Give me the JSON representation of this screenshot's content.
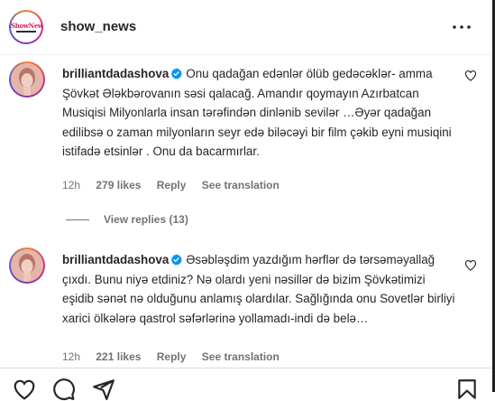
{
  "post": {
    "username": "show_news",
    "avatar_logo_text": "ShowNews"
  },
  "comments": [
    {
      "username": "brilliantdadashova",
      "text": "Onu qadağan edənlər ölüb gedəcəklər- amma Şövkət Ələkbərovanın səsi qalacağ. Amandır qoymayın Azırbatcan Musiqisi Milyonlarla insan tərəfindən dinlənib sevilər …Əyər qadağan edilibsə o zaman milyonların seyr edə biləcəyi bir film çəkib eyni musiqini istifadə etsinlər . Onu da bacarmırlar.",
      "time": "12h",
      "likes": "279 likes",
      "reply_label": "Reply",
      "translate_label": "See translation",
      "view_replies": "View replies (13)"
    },
    {
      "username": "brilliantdadashova",
      "text": "Əsəbləşdim yazdığım hərflər də tərsəməyallağ çıxdı. Bunu niyə etdiniz? Nə olardı yeni nəsillər də bizim Şövkətimizi eşidib sənət nə olduğunu anlamış olardılar. Sağlığında onu Sovetlər birliyi xarici ölkələrə qastrol səfərlərinə yollamadı-indi də belə…",
      "time": "12h",
      "likes": "221 likes",
      "reply_label": "Reply",
      "translate_label": "See translation"
    }
  ],
  "colors": {
    "text": "#262626",
    "secondary": "#737373",
    "verified": "#0095f6",
    "divider": "#dbdbdb"
  },
  "icons": [
    "more-icon",
    "verified-badge-icon",
    "heart-icon",
    "comment-icon",
    "share-icon",
    "bookmark-icon"
  ]
}
